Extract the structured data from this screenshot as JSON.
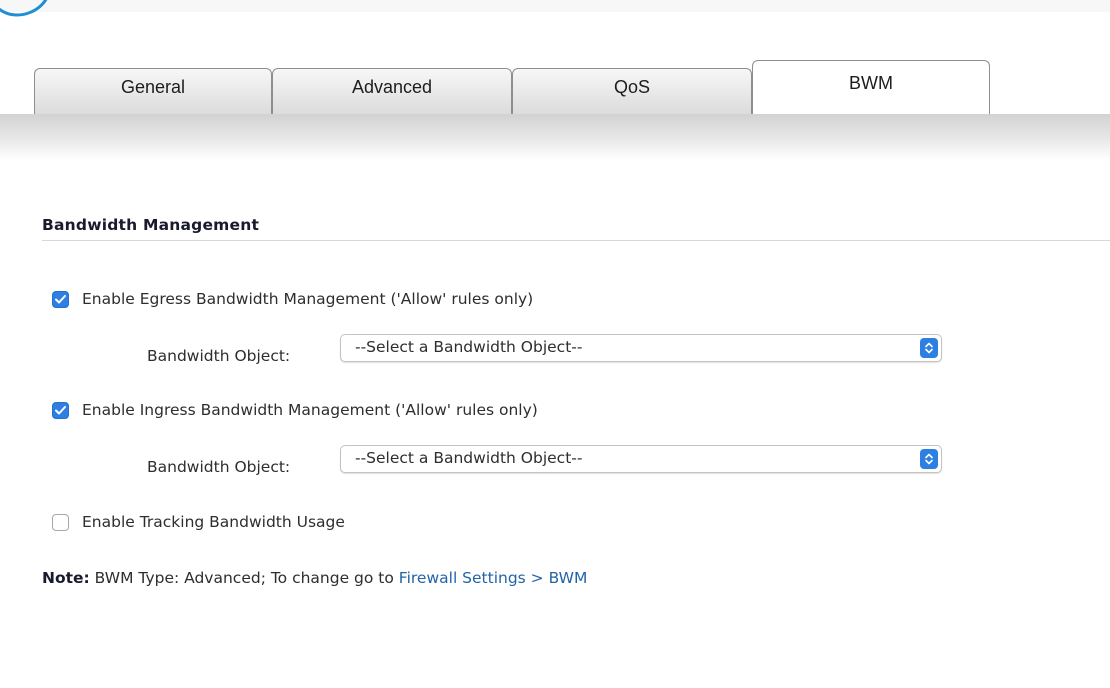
{
  "tabs": [
    {
      "label": "General",
      "active": false
    },
    {
      "label": "Advanced",
      "active": false
    },
    {
      "label": "QoS",
      "active": false
    },
    {
      "label": "BWM",
      "active": true
    }
  ],
  "section": {
    "title": "Bandwidth Management"
  },
  "egress": {
    "label": "Enable Egress Bandwidth Management ('Allow' rules only)",
    "checked": true,
    "object_label": "Bandwidth Object:",
    "object_value": "--Select a Bandwidth Object--"
  },
  "ingress": {
    "label": "Enable Ingress Bandwidth Management ('Allow' rules only)",
    "checked": true,
    "object_label": "Bandwidth Object:",
    "object_value": "--Select a Bandwidth Object--"
  },
  "tracking": {
    "label": "Enable Tracking Bandwidth Usage",
    "checked": false
  },
  "note": {
    "prefix": "Note:",
    "text": " BWM Type: Advanced; To change go to ",
    "link": "Firewall Settings > BWM"
  },
  "colors": {
    "accent": "#2d7fe3",
    "link": "#2364a8",
    "logo": "#1e8fd5"
  },
  "icons": {
    "checkmark": "checkmark-icon",
    "select_arrows": "up-down-chevron-icon"
  }
}
